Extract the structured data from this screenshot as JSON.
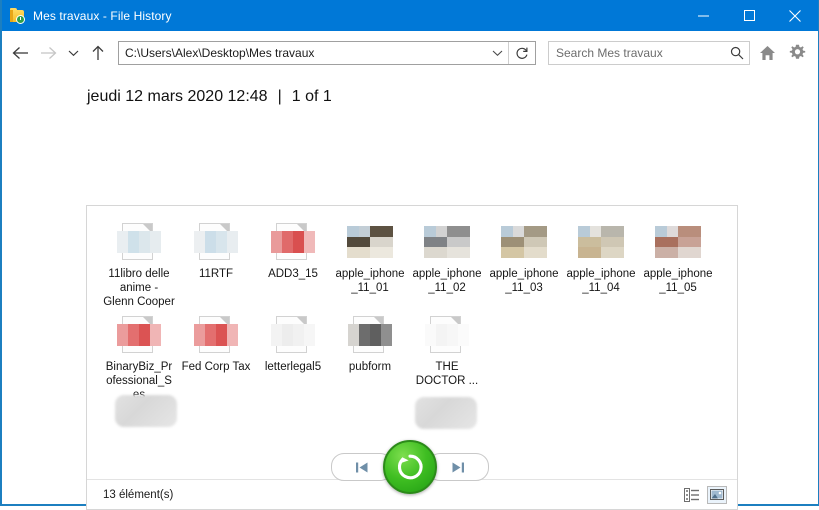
{
  "window": {
    "title": "Mes travaux  - File History",
    "icon": "folder-history-icon",
    "accent_color": "#0078d7",
    "border_color": "#1c7fc0",
    "controls": {
      "minimize": "minimize-icon",
      "maximize": "maximize-icon",
      "close": "close-icon"
    }
  },
  "toolbar": {
    "back": "back-arrow-icon",
    "forward": "forward-arrow-icon",
    "recent": "chevron-down-icon",
    "up": "up-arrow-icon",
    "address_value": "C:\\Users\\Alex\\Desktop\\Mes travaux",
    "address_caret": "chevron-down-icon",
    "refresh": "refresh-icon",
    "search_placeholder": "Search Mes travaux",
    "search_value": "",
    "search_icon": "search-icon",
    "home": "home-icon",
    "settings": "gear-icon"
  },
  "header": {
    "date": "jeudi 12 mars 2020 12:48",
    "separator": "|",
    "position": "1 of 1"
  },
  "files": [
    {
      "label": "11libro delle anime - Glenn Cooper",
      "thumb": "document",
      "colors": [
        "#e9eef1",
        "#cfe1ea",
        "#dce7ec",
        "#e6ecef"
      ]
    },
    {
      "label": "11RTF",
      "thumb": "document",
      "colors": [
        "#eceff1",
        "#ccdee9",
        "#d8e5ec",
        "#e8edf0"
      ]
    },
    {
      "label": "ADD3_15",
      "thumb": "document",
      "colors": [
        "#e99a9a",
        "#e06a6a",
        "#d94f4f",
        "#f0b9b9"
      ]
    },
    {
      "label": "apple_iphone_11_01",
      "thumb": "photo",
      "colors": [
        "#c3ced6",
        "#5d5242",
        "#534a3c",
        "#d9d5cc",
        "#e4ddcd",
        "#ece8de"
      ]
    },
    {
      "label": "apple_iphone_11_02",
      "thumb": "photo",
      "colors": [
        "#d2d2d2",
        "#8f8f8f",
        "#7f8286",
        "#c9c9c9",
        "#dcd8cf",
        "#e6e3dc"
      ]
    },
    {
      "label": "apple_iphone_11_03",
      "thumb": "photo",
      "colors": [
        "#dadada",
        "#a49a85",
        "#9d9077",
        "#cfc8b6",
        "#d4c6a4",
        "#e3dccb"
      ]
    },
    {
      "label": "apple_iphone_11_04",
      "thumb": "photo",
      "colors": [
        "#e4e2dd",
        "#b9b6ac",
        "#cbbd9d",
        "#cfc7b4",
        "#c8b491",
        "#ddd6c4"
      ]
    },
    {
      "label": "apple_iphone_11_05",
      "thumb": "photo",
      "colors": [
        "#dedada",
        "#b98e7c",
        "#a9705e",
        "#c8a296",
        "#cbb0a6",
        "#e0d6d0"
      ]
    },
    {
      "label": "BinaryBiz_Professional_S es",
      "thumb": "document",
      "colors": [
        "#eb9c9c",
        "#e36f6f",
        "#db5353",
        "#f0b5b5"
      ],
      "redacted": true
    },
    {
      "label": "Fed Corp Tax",
      "thumb": "document",
      "colors": [
        "#eb9c9c",
        "#e36f6f",
        "#db5353",
        "#f0b5b5"
      ]
    },
    {
      "label": "letterlegal5",
      "thumb": "document",
      "colors": [
        "#f3f3f3",
        "#ededed",
        "#f1f1f1",
        "#f6f6f6"
      ]
    },
    {
      "label": "pubform",
      "thumb": "document",
      "colors": [
        "#d6d4d0",
        "#6d6d6d",
        "#5f5f5f",
        "#8f8f8f"
      ]
    },
    {
      "label": "THE DOCTOR ...",
      "thumb": "document",
      "colors": [
        "#fafafa",
        "#f4f4f4",
        "#f7f7f7",
        "#fbfbfb"
      ],
      "redacted": true
    }
  ],
  "status": {
    "count_text": "13 élément(s)",
    "view_details": "details-view-icon",
    "view_large_icons": "large-icons-view-icon",
    "active_view": "large-icons"
  },
  "bottom_nav": {
    "prev": "previous-version-icon",
    "restore": "restore-icon",
    "next": "next-version-icon",
    "restore_color": "#3fbe22"
  }
}
